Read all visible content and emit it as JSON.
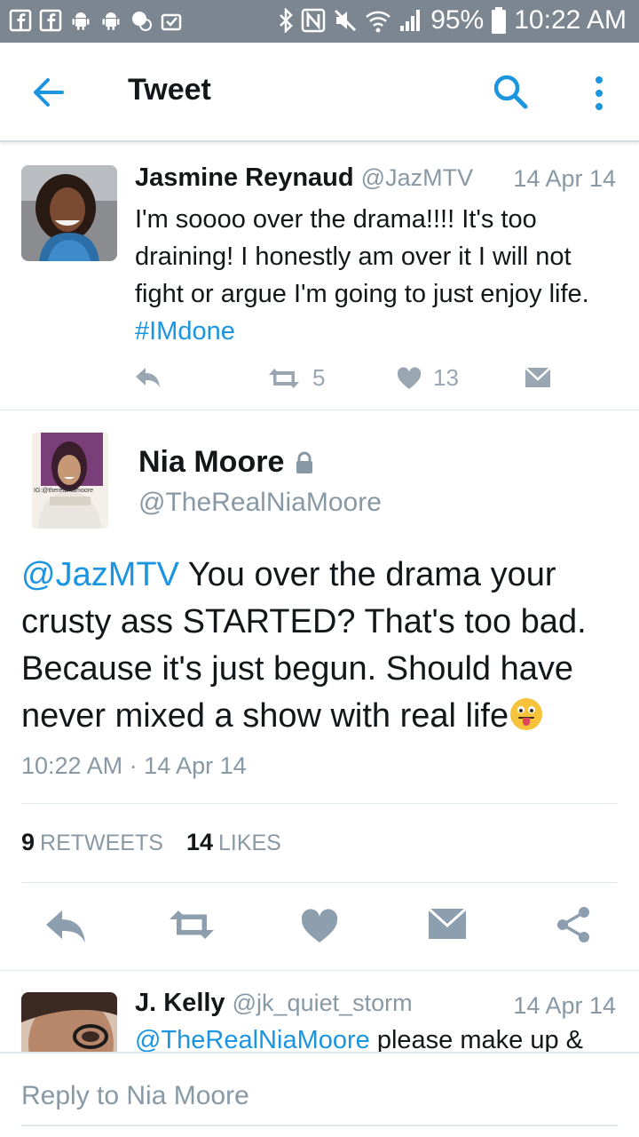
{
  "status_bar": {
    "battery": "95%",
    "time": "10:22 AM",
    "left_icons": [
      "facebook-icon",
      "facebook-icon",
      "android-icon",
      "android-icon",
      "chat-icon",
      "clipboard-check-icon"
    ],
    "right_icons": [
      "bluetooth-icon",
      "nfc-icon",
      "mute-icon",
      "wifi-icon",
      "signal-icon",
      "battery-icon"
    ]
  },
  "toolbar": {
    "title": "Tweet"
  },
  "tweets": [
    {
      "name": "Jasmine Reynaud",
      "handle": "@JazMTV",
      "date": "14 Apr 14",
      "text": "I'm soooo over the drama!!!! It's too draining! I honestly am over it I will not fight or argue I'm going to just enjoy life. ",
      "hashtag": "#IMdone",
      "retweets": "5",
      "likes": "13"
    }
  ],
  "main_tweet": {
    "name": "Nia Moore",
    "handle": "@TheRealNiaMoore",
    "avatar_caption": "IG:@thereainiamoore",
    "mention": "@JazMTV",
    "text": " You over the drama your crusty ass STARTED? That's too bad. Because it's just begun. Should have never mixed a show with real life",
    "timestamp": "10:22 AM · 14 Apr 14",
    "retweets_count": "9",
    "retweets_label": "RETWEETS",
    "likes_count": "14",
    "likes_label": "LIKES"
  },
  "reply_preview": {
    "name": "J. Kelly",
    "handle": "@jk_quiet_storm",
    "date": "14 Apr 14",
    "mention": "@TheRealNiaMoore",
    "text": " please make up &"
  },
  "reply_bar": {
    "placeholder": "Reply to Nia Moore"
  },
  "colors": {
    "accent": "#1b95e0",
    "status_bar": "#7c8690",
    "secondary_text": "#8899a6",
    "icon_gray": "#9aa6b2",
    "main_action_gray": "#8d9eae"
  }
}
